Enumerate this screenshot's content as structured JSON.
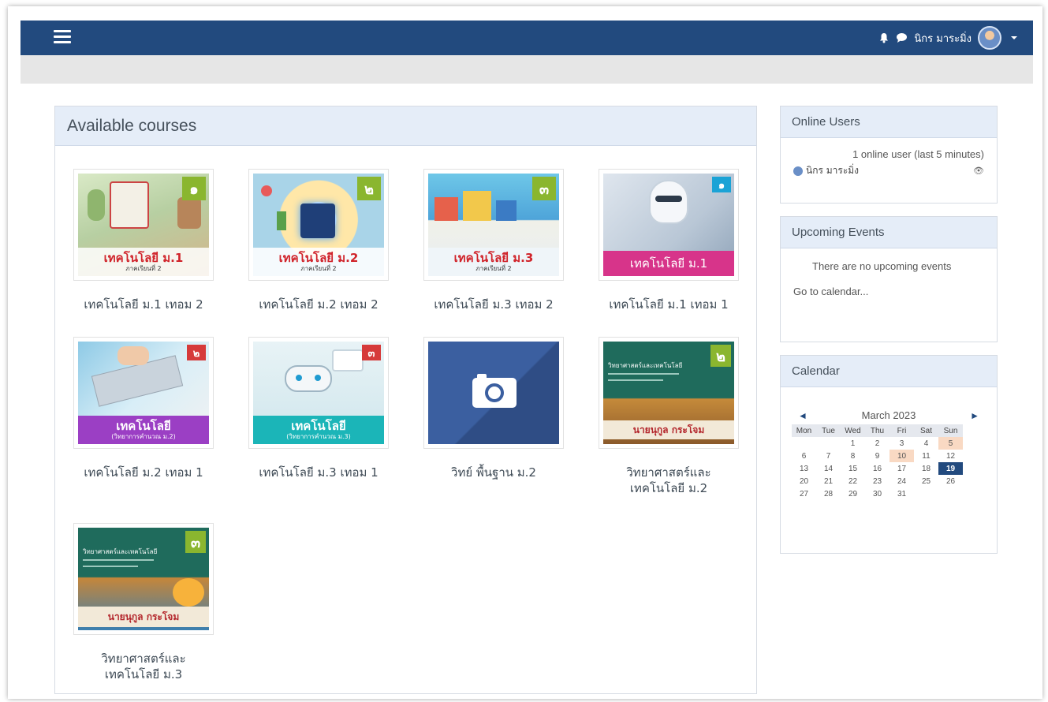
{
  "navbar": {
    "username": "นิกร มาระมิ่ง",
    "accent_color": "#224a7e"
  },
  "main": {
    "title": "Available courses",
    "courses": [
      {
        "name": "เทคโนโลยี ม.1 เทอม 2",
        "thumb_title": "เทคโนโลยี ม.1",
        "thumb_sub": "ภาคเรียนที่ 2",
        "badge": "๑"
      },
      {
        "name": "เทคโนโลยี ม.2 เทอม 2",
        "thumb_title": "เทคโนโลยี ม.2",
        "thumb_sub": "ภาคเรียนที่ 2",
        "badge": "๒"
      },
      {
        "name": "เทคโนโลยี ม.3 เทอม 2",
        "thumb_title": "เทคโนโลยี ม.3",
        "thumb_sub": "ภาคเรียนที่ 2",
        "badge": "๓"
      },
      {
        "name": "เทคโนโลยี ม.1 เทอม 1",
        "thumb_title": "เทคโนโลยี ม.1",
        "thumb_sub": "",
        "badge": "๑"
      },
      {
        "name": "เทคโนโลยี ม.2 เทอม 1",
        "thumb_title": "เทคโนโลยี",
        "thumb_sub": "(วิทยาการคำนวณ ม.2)",
        "badge": "๒"
      },
      {
        "name": "เทคโนโลยี ม.3 เทอม 1",
        "thumb_title": "เทคโนโลยี",
        "thumb_sub": "(วิทยาการคำนวณ ม.3)",
        "badge": "๓"
      },
      {
        "name": "วิทย์ พื้นฐาน ม.2",
        "thumb_title": "",
        "thumb_sub": "",
        "badge": ""
      },
      {
        "name": "วิทยาศาสตร์และเทคโนโลยี ม.2",
        "thumb_title": "นายนุกูล กระโจม",
        "thumb_sub": "วิทยาศาสตร์และเทคโนโลยี",
        "badge": "๒"
      },
      {
        "name": "วิทยาศาสตร์และเทคโนโลยี ม.3",
        "thumb_title": "นายนุกูล กระโจม",
        "thumb_sub": "วิทยาศาสตร์และเทคโนโลยี",
        "badge": "๓"
      }
    ]
  },
  "online_users": {
    "title": "Online Users",
    "summary": "1 online user (last 5 minutes)",
    "user": "นิกร มาระมิ่ง"
  },
  "upcoming_events": {
    "title": "Upcoming Events",
    "empty_text": "There are no upcoming events",
    "calendar_link": "Go to calendar..."
  },
  "calendar": {
    "title": "Calendar",
    "month": "March 2023",
    "prev": "◄",
    "next": "►",
    "weekdays": [
      "Mon",
      "Tue",
      "Wed",
      "Thu",
      "Fri",
      "Sat",
      "Sun"
    ],
    "weeks": [
      [
        "",
        "",
        "1",
        "2",
        "3",
        "4",
        "5"
      ],
      [
        "6",
        "7",
        "8",
        "9",
        "10",
        "11",
        "12"
      ],
      [
        "13",
        "14",
        "15",
        "16",
        "17",
        "18",
        "19"
      ],
      [
        "20",
        "21",
        "22",
        "23",
        "24",
        "25",
        "26"
      ],
      [
        "27",
        "28",
        "29",
        "30",
        "31",
        "",
        ""
      ]
    ],
    "today": "19",
    "highlighted": [
      "5",
      "10"
    ]
  }
}
